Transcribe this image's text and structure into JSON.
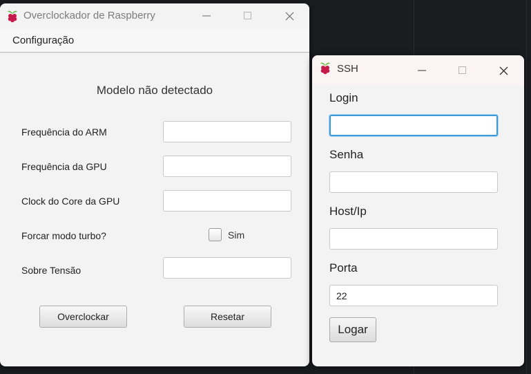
{
  "main_window": {
    "title": "Overclockador de Raspberry",
    "icon": "raspberry-pi-icon",
    "menu": {
      "configuracao": "Configuração"
    },
    "heading": "Modelo não detectado",
    "fields": {
      "arm_freq": {
        "label": "Frequência do ARM",
        "value": ""
      },
      "gpu_freq": {
        "label": "Frequência da GPU",
        "value": ""
      },
      "gpu_core_clock": {
        "label": "Clock do Core da GPU",
        "value": ""
      },
      "turbo": {
        "label": "Forcar modo turbo?",
        "checkbox_label": "Sim",
        "checked": false
      },
      "over_voltage": {
        "label": "Sobre Tensão",
        "value": ""
      }
    },
    "buttons": {
      "overclock": "Overclockar",
      "reset": "Resetar"
    }
  },
  "ssh_window": {
    "title": "SSH",
    "icon": "raspberry-pi-icon",
    "login": {
      "label": "Login",
      "value": ""
    },
    "password": {
      "label": "Senha",
      "value": ""
    },
    "host": {
      "label": "Host/Ip",
      "value": ""
    },
    "port": {
      "label": "Porta",
      "value": "22"
    },
    "login_button": "Logar"
  },
  "colors": {
    "desktop": "#1b1c20",
    "window_bg": "#f3f3f3",
    "focus_ring": "#3a9bdc",
    "raspberry_red": "#c51a4a",
    "leaf_green": "#6cc04a"
  }
}
